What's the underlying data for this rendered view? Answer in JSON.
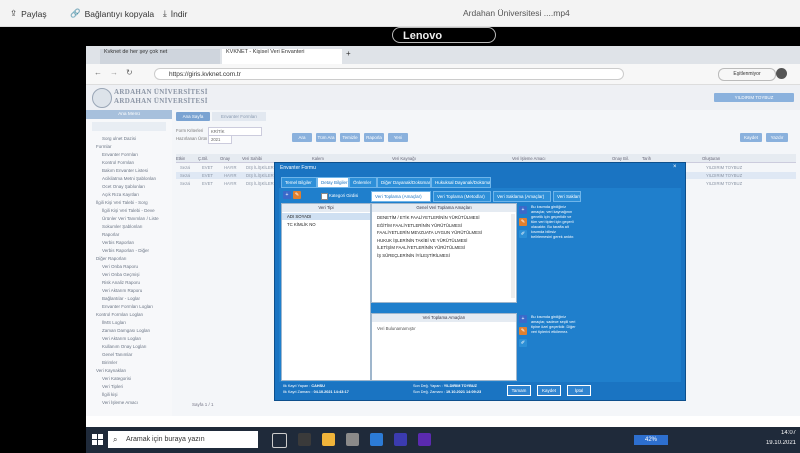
{
  "sharebar": {
    "share_label": "Paylaş",
    "copy_link_label": "Bağlantıyı kopyala",
    "download_label": "İndir",
    "file_title": "Ardahan Üniversitesi ....mp4"
  },
  "laptop_brand": "Lenovo",
  "browser": {
    "tab1": "Kvknet de her şey çok net",
    "tab2": "KVKNET - Kişisel Veri Envanteri",
    "url": "https://giris.kvknet.com.tr",
    "profile_label": "Eşitlenmiyor"
  },
  "app": {
    "org_name_1": "ARDAHAN ÜNİVERSİTESİ",
    "org_name_2": "ARDAHAN ÜNİVERSİTESİ",
    "user_button": "YILDIRIM TOYBUZ",
    "sidebar_header": "Ana Menü",
    "sidebar_items": [
      "Sorg ulnet Dazisi",
      "Formlar",
      "Envanter Formları",
      "Kontrol Formları",
      "Bakım Envanter Listesi",
      "Acikilatma Metni Şablonları",
      "Ocet Onay Şablonları",
      "Açık Rıza Kayıtları",
      "İlgili Kişi Veri Talebi - Sorg",
      "İlgili Kişi Veri Talebi - Deve",
      "Ürünler Veri Tanımları / Liste",
      "Sokumler Şablonları",
      "Raporlar",
      "Verbis Raporları",
      "Verbis Raporları - Diğer",
      "Diğer Raporları",
      "Veri Onba Raporu",
      "Veri Onba Geçmişi",
      "Risk Analiz Raporu",
      "Veri Aktarım Raporu",
      "Bağlantılar - Loglar",
      "Envanter Formları Logları",
      "Kontrol Formları Logları",
      "İlMS Logları",
      "Zaman Damgası Logları",
      "Veri Aktarım Logları",
      "Kullanım Onay Logları",
      "Genel Tanımlar",
      "Birimler",
      "Veri Kaynakları",
      "Veri Kategorisi",
      "Veri Tipleri",
      "İlgili kişi",
      "Veri İşleme Amacı"
    ],
    "page_tab_active": "Ana Sayfa",
    "page_tab_2": "Envanter Formları",
    "filter_label_1": "Form Kriterleri",
    "filter_value_1": "KRİTİK",
    "filter_label_2": "Hazırlanan Ürün",
    "filter_value_2": "2021",
    "toolbar_buttons": [
      "Ara",
      "Tüm Ara",
      "Temizle",
      "Raporla",
      "Yeni"
    ],
    "right_buttons": [
      "Kaydet",
      "Yazdır"
    ],
    "columns": [
      "Etkin",
      "Ç.Bil.",
      "Onay",
      "Veri Sahibi",
      "Kalem",
      "Veri Kaynağı",
      "Veri İşleme Amacı",
      "Onay Bil.",
      "Tarih",
      "Oluşturan"
    ],
    "rows": [
      [
        "Sezal",
        "EVET",
        "HAYIR",
        "DIŞ İLİŞKİLER KOORDİNATÖRLÜĞÜ",
        "SATRAN BİLGİLERİ",
        "PALABİNLİ HİZMETLER YÖNETİM",
        "yazılık",
        "4.10.2021",
        "CAHSU",
        "YILDIRIM TOYBUZ"
      ],
      [
        "Sezal",
        "EVET",
        "HAYIR",
        "DIŞ İLİŞKİLER KOORDİNATÖRLÜĞÜ",
        "KİMLİK BİLGİLERİ",
        "PALABİNLİ HİZMETLER YÖNETİM",
        "yazılık",
        "4.10.2021",
        "CAHSU",
        "YILDIRIM TOYBUZ"
      ],
      [
        "Sezal",
        "EVET",
        "HAYIR",
        "DIŞ İLİŞKİLER",
        "İLETİŞİM",
        "EĞİTİM FAALİYETLERİ",
        "yazılık",
        "4.10.2021",
        "CAHSU",
        "YILDIRIM TOYBUZ"
      ]
    ],
    "pager": "Sayfa 1 / 1"
  },
  "modal": {
    "title": "Envanter Formu",
    "tabs": [
      "Temel Bilgiler",
      "Detay Bilgiler",
      "Önlemler",
      "Diğer Dayanak/Dokümanlar",
      "Hukuksal Dayanak/Dokümanlar"
    ],
    "category_label": "Kategori Girdisi",
    "subtabs": [
      "Veri Toplama (Amaçlar)",
      "Veri Toplama (Metodlar)",
      "Veri Saklama (Amaçlar)",
      "Veri Saklam"
    ],
    "veri_tipi_header": "Veri Tipi",
    "veri_tipi_items": [
      "ADI SOYADI",
      "TC KİMLİK NO"
    ],
    "purposes_header": "Genel Veri Toplama Amaçları",
    "purposes": [
      "DENETİM / ETİK FAALİYETLERİNİN YÜRÜTÜLMESİ",
      "EĞİTİM FAALİYETLERİNİN YÜRÜTÜLMESİ",
      "FAALİYETLERİN MEVZUATA UYGUN YÜRÜTÜLMESİ",
      "HUKUK İŞLERİNİN TAKİBİ VE YÜRÜTÜLMESİ",
      "İLETİŞİM FAALİYETLERİNİN YÜRÜTÜLMESİ",
      "İŞ SÜREÇLERİNİN İYİLEŞTİRİLMESİ"
    ],
    "collection_header": "Veri Toplama Amaçları",
    "collection_empty": "Veri Bulunamamıştır",
    "note_top": "Bu kısımda girdiğiniz amaçlar, veri kaynağının genelik için geçerlidir ve tüm veri tipleri için geçerli olacaktır. Bu tarafta alt kısımda bilirsiz belirlemesini gerek arıktır.",
    "note_bottom": "Bu kısımda girdiğiniz amaçlar, sadece seçili veri tipine özel geçerlidir. Diğer veri tiplerini etkilemez.",
    "created_by_label": "İlk Kayıt Yapan :",
    "created_by": "CAHSU",
    "created_time_label": "İlk Kayıt Zamanı :",
    "created_time": "04.10.2021 14:43:17",
    "updated_by_label": "Son Değ. Yapan :",
    "updated_by": "YILDIRIM TOYBUZ",
    "updated_time_label": "Son Değ. Zamanı :",
    "updated_time": "19.10.2021 14:09:23",
    "buttons": [
      "Tamam",
      "Kaydet",
      "İptal"
    ]
  },
  "taskbar": {
    "search_placeholder": "Aramak için buraya yazın",
    "battery": "42%",
    "time": "14:07",
    "date": "19.10.2021"
  },
  "colors": {
    "modal_blue": "#1a74c2",
    "app_button": "#8ab1dd",
    "taskbar": "#1f2a3a"
  }
}
